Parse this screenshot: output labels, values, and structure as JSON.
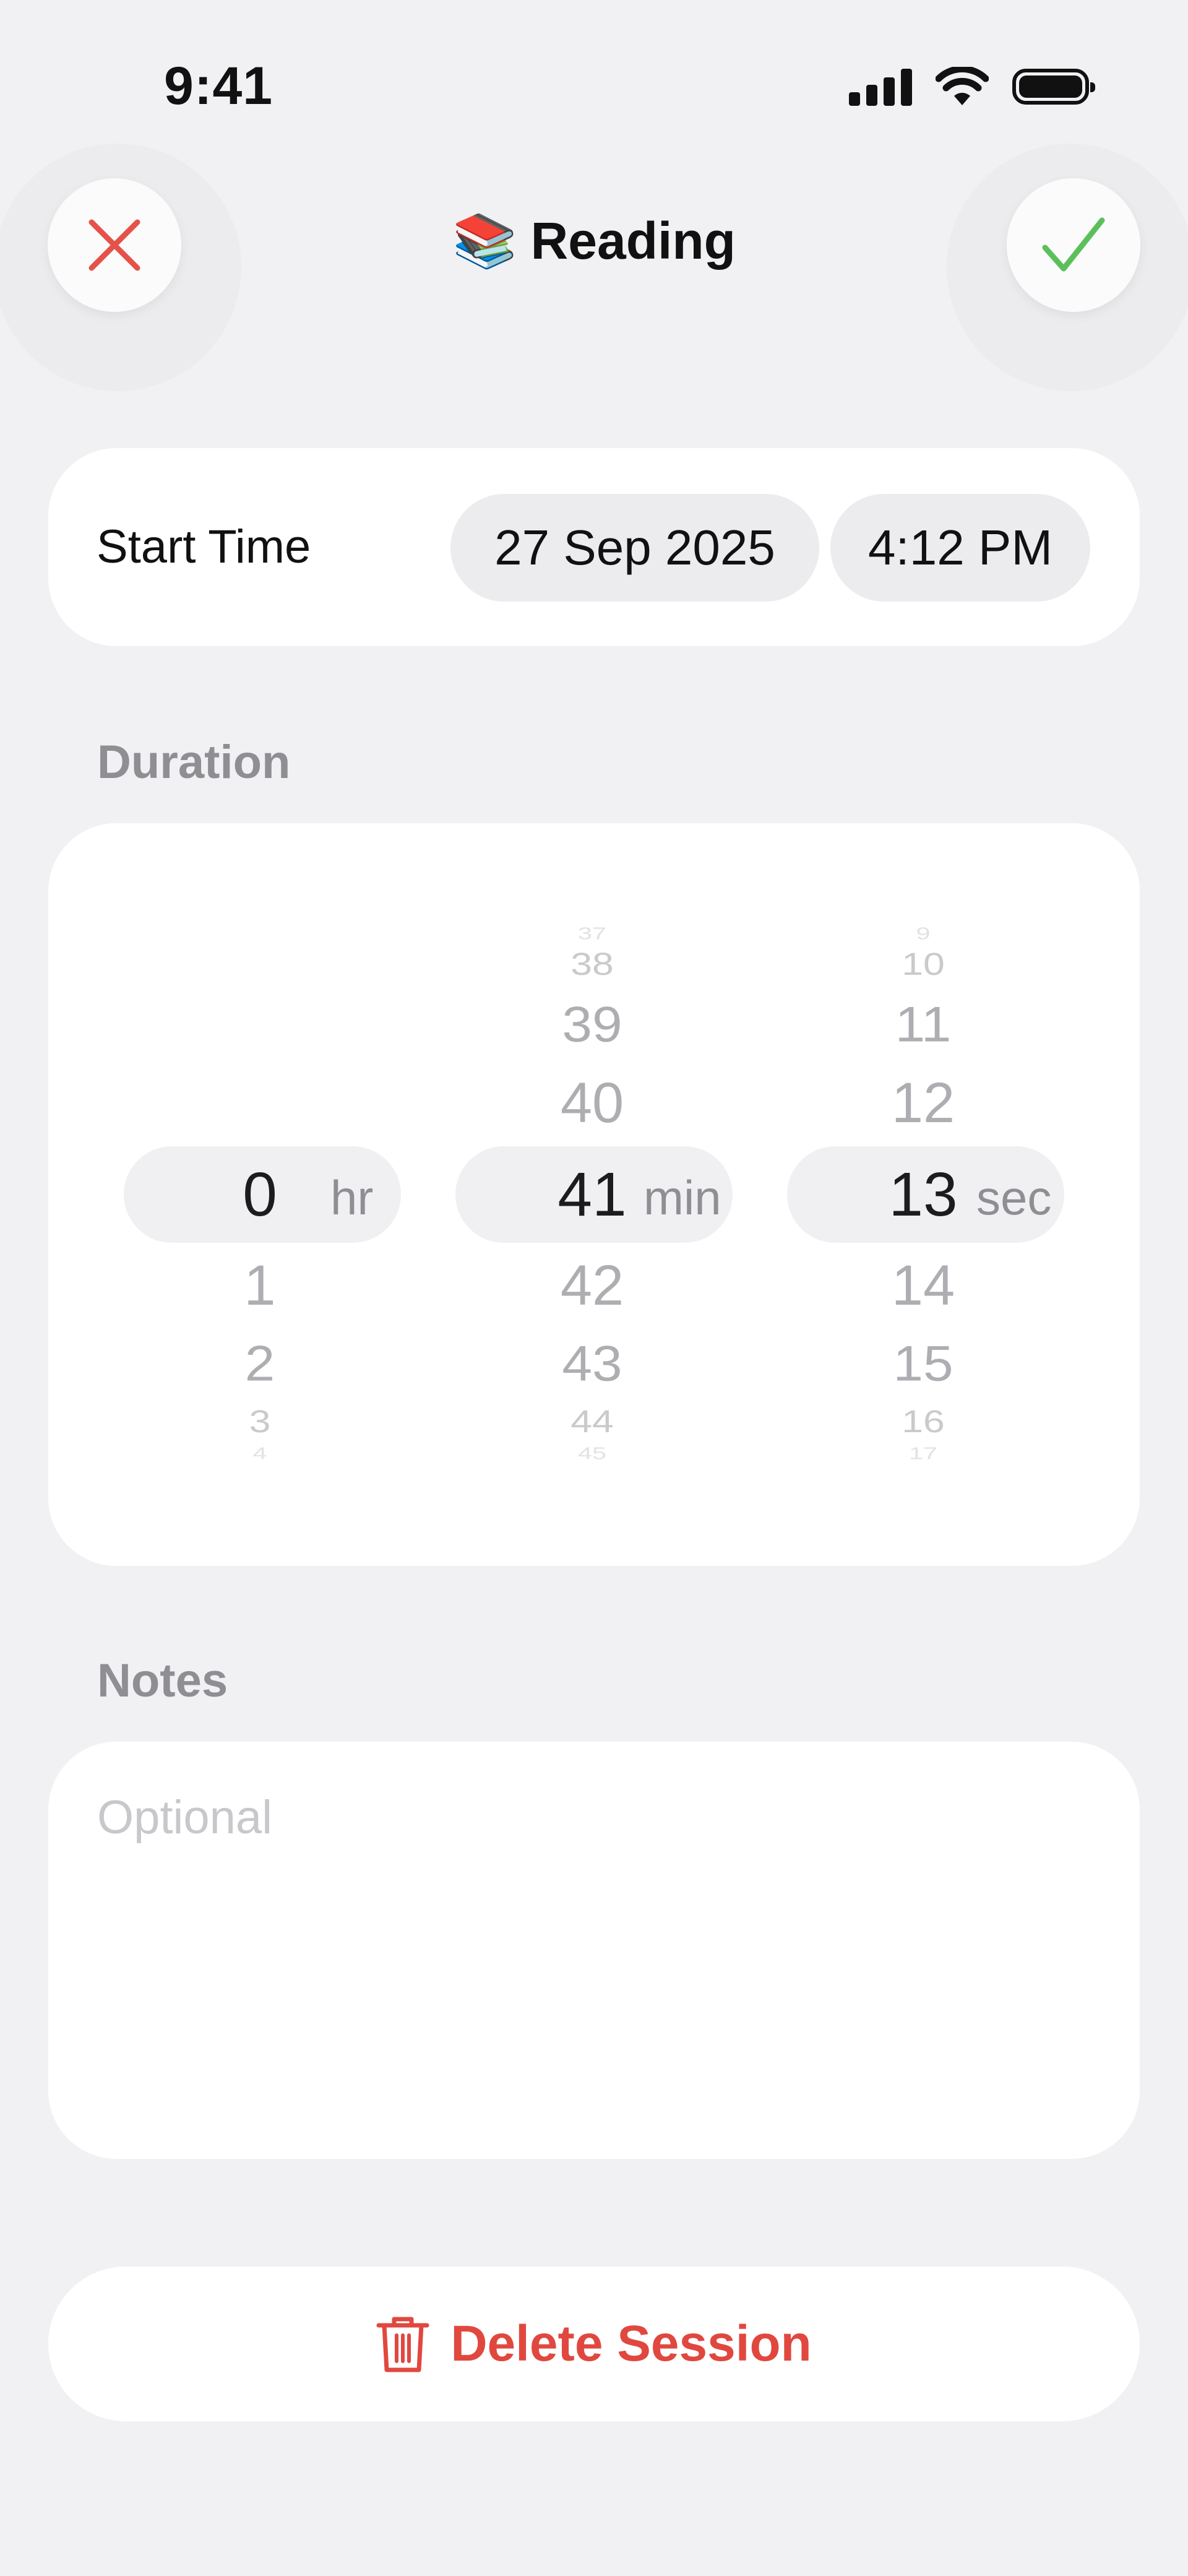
{
  "status_bar": {
    "time": "9:41"
  },
  "header": {
    "title": "Reading",
    "title_emoji": "📚",
    "cancel_color": "#e5524a",
    "confirm_color": "#5cc05a"
  },
  "start_time": {
    "label": "Start Time",
    "date": "27 Sep 2025",
    "time": "4:12 PM"
  },
  "duration": {
    "label": "Duration",
    "hours": {
      "values": [
        "0",
        "1",
        "2",
        "3",
        "4"
      ],
      "selected": "0",
      "unit": "hr"
    },
    "minutes": {
      "values": [
        "37",
        "38",
        "39",
        "40",
        "41",
        "42",
        "43",
        "44",
        "45"
      ],
      "selected": "41",
      "unit": "min"
    },
    "seconds": {
      "values": [
        "9",
        "10",
        "11",
        "12",
        "13",
        "14",
        "15",
        "16",
        "17"
      ],
      "selected": "13",
      "unit": "sec"
    }
  },
  "notes": {
    "label": "Notes",
    "placeholder": "Optional"
  },
  "delete": {
    "label": "Delete Session",
    "color": "#e0483f"
  }
}
